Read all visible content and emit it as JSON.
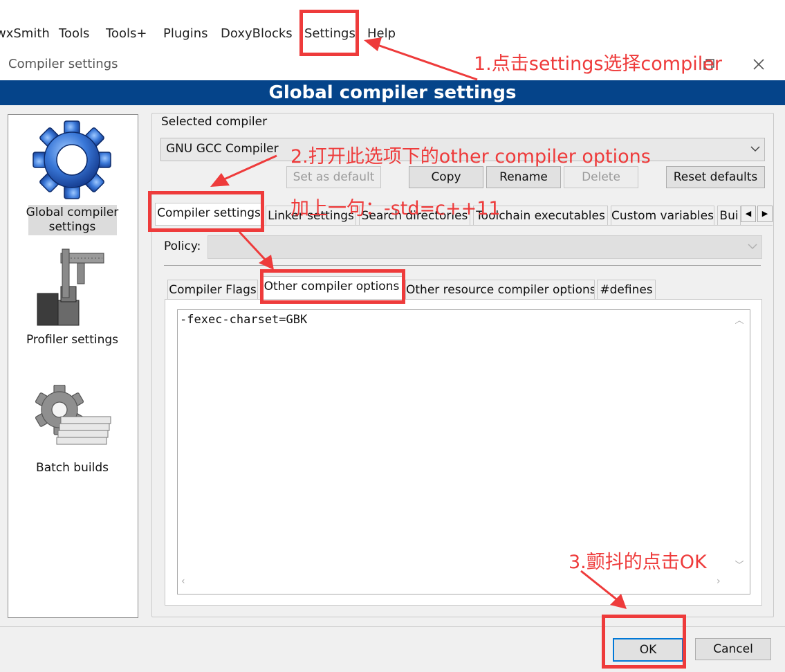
{
  "menubar": {
    "items": [
      "wxSmith",
      "Tools",
      "Tools+",
      "Plugins",
      "DoxyBlocks",
      "Settings",
      "Help"
    ]
  },
  "window": {
    "title": "Compiler settings",
    "banner": "Global compiler settings"
  },
  "sidebar": {
    "items": [
      {
        "label_line1": "Global compiler",
        "label_line2": "settings",
        "icon": "gear-icon",
        "selected": true
      },
      {
        "label_line1": "Profiler settings",
        "label_line2": "",
        "icon": "caliper-icon",
        "selected": false
      },
      {
        "label_line1": "Batch builds",
        "label_line2": "",
        "icon": "gear-stack-icon",
        "selected": false
      }
    ]
  },
  "compiler": {
    "group_label": "Selected compiler",
    "selected": "GNU GCC Compiler",
    "buttons": {
      "set_default": "Set as default",
      "copy": "Copy",
      "rename": "Rename",
      "delete": "Delete",
      "reset": "Reset defaults"
    }
  },
  "tabs": {
    "top": [
      "Compiler settings",
      "Linker settings",
      "Search directories",
      "Toolchain executables",
      "Custom variables",
      "Bui"
    ],
    "policy_label": "Policy:",
    "sub": [
      "Compiler Flags",
      "Other compiler options",
      "Other resource compiler options",
      "#defines"
    ]
  },
  "editor": {
    "content": "-fexec-charset=GBK"
  },
  "footer": {
    "ok": "OK",
    "cancel": "Cancel"
  },
  "annotations": {
    "step1": "1.点击settings选择compiler",
    "step2": "2.打开此选项下的other compiler options",
    "step2b": "加上一句：-std=c++11",
    "step3": "3.颤抖的点击OK"
  },
  "colors": {
    "banner": "#05448a",
    "annotation": "#ee3b3b"
  }
}
